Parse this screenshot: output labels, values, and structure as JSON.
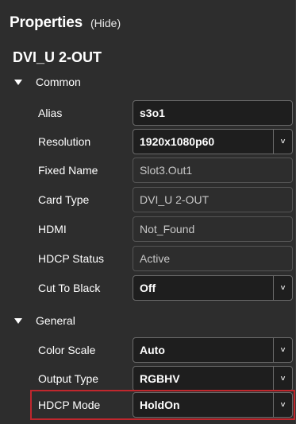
{
  "header": {
    "title": "Properties",
    "hide_label": "(Hide)"
  },
  "device_name": "DVI_U 2-OUT",
  "sections": {
    "common": {
      "label": "Common",
      "fields": {
        "alias": {
          "label": "Alias",
          "value": "s3o1"
        },
        "resolution": {
          "label": "Resolution",
          "value": "1920x1080p60"
        },
        "fixed_name": {
          "label": "Fixed Name",
          "value": "Slot3.Out1"
        },
        "card_type": {
          "label": "Card Type",
          "value": "DVI_U 2-OUT"
        },
        "hdmi": {
          "label": "HDMI",
          "value": "Not_Found"
        },
        "hdcp_status": {
          "label": "HDCP Status",
          "value": "Active"
        },
        "cut_to_black": {
          "label": "Cut To Black",
          "value": "Off"
        }
      }
    },
    "general": {
      "label": "General",
      "fields": {
        "color_scale": {
          "label": "Color Scale",
          "value": "Auto"
        },
        "output_type": {
          "label": "Output Type",
          "value": "RGBHV"
        },
        "hdcp_mode": {
          "label": "HDCP Mode",
          "value": "HoldOn"
        }
      }
    }
  },
  "icons": {
    "expand": "expanded-triangle-icon",
    "dropdown": "chevron-down-icon"
  },
  "colors": {
    "highlight": "#c0272d",
    "panel_bg": "#2d2d2d",
    "field_bg": "#1e1e1e"
  }
}
